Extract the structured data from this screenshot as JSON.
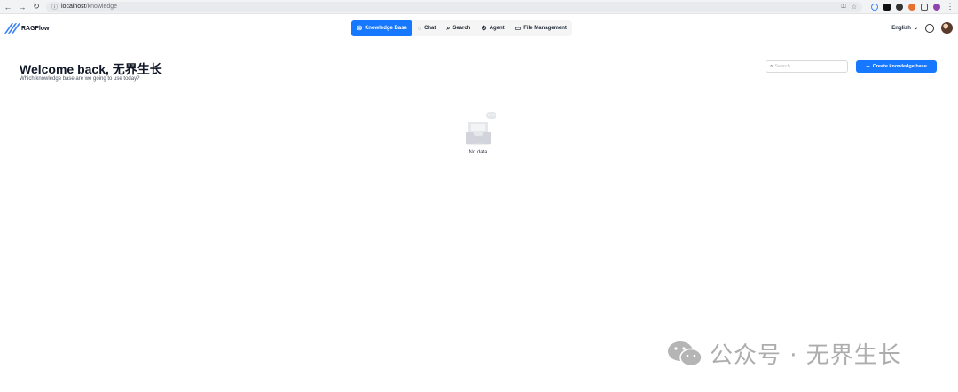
{
  "browser": {
    "url_host": "localhost",
    "url_path": "/knowledge"
  },
  "app": {
    "name": "RAGFlow"
  },
  "nav": {
    "items": [
      {
        "label": "Knowledge Base",
        "icon": "database-icon"
      },
      {
        "label": "Chat",
        "icon": "chat-icon"
      },
      {
        "label": "Search",
        "icon": "search-icon"
      },
      {
        "label": "Agent",
        "icon": "agent-icon"
      },
      {
        "label": "File Management",
        "icon": "folder-icon"
      }
    ],
    "active_index": 0
  },
  "header_right": {
    "language": "English"
  },
  "main": {
    "title": "Welcome back, 无界生长",
    "subtitle": "Which knowledge base are we going to use today?",
    "search_placeholder": "Search",
    "create_button": "Create knowledge base",
    "empty_text": "No data"
  },
  "watermark": {
    "text": "公众号 · 无界生长"
  },
  "colors": {
    "accent": "#1677ff",
    "nav_bg": "#f5f5f5"
  }
}
